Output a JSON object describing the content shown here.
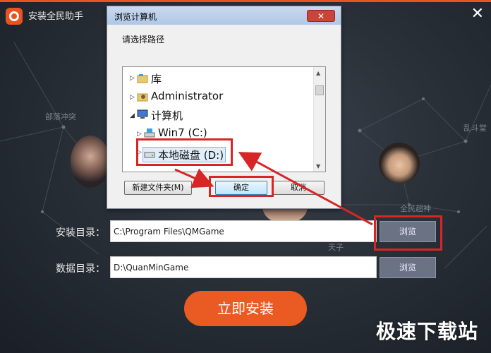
{
  "app": {
    "title": "安装全民助手",
    "close_glyph": "✕",
    "install_dir_label": "安装目录：",
    "install_dir_value": "C:\\Program Files\\QMGame",
    "data_dir_label": "数据目录：",
    "data_dir_value": "D:\\QuanMinGame",
    "browse_label": "浏览",
    "install_button": "立即安装",
    "background_labels": [
      "部落冲突",
      "乱斗堂",
      "全民超神",
      "天子"
    ],
    "watermark": "极速下载站",
    "accent_color": "#e8531f"
  },
  "dialog": {
    "title": "浏览计算机",
    "close_glyph": "✕",
    "prompt": "请选择路径",
    "tree": [
      {
        "label": "库",
        "icon": "library-folder-icon",
        "expander": "▷"
      },
      {
        "label": "Administrator",
        "icon": "user-folder-icon",
        "expander": "▷"
      },
      {
        "label": "计算机",
        "icon": "computer-icon",
        "expander": "◢"
      },
      {
        "label": "Win7 (C:)",
        "icon": "system-drive-icon",
        "expander": "▷"
      },
      {
        "label": "本地磁盘 (D:)",
        "icon": "drive-icon",
        "expander": "▷",
        "selected": true
      }
    ],
    "new_folder_button": "新建文件夹(M)",
    "ok_button": "确定",
    "cancel_button": "取消"
  }
}
